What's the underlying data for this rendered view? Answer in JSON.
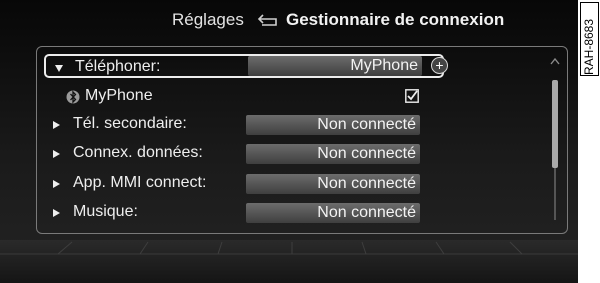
{
  "header": {
    "parent": "Réglages",
    "current": "Gestionnaire de connexion",
    "back_icon": "return-arrow-icon"
  },
  "rows": [
    {
      "label": "Téléphoner:",
      "value": "MyPhone",
      "expanded": true,
      "selected": true
    },
    {
      "label": "Tél. secondaire:",
      "value": "Non connecté"
    },
    {
      "label": "Connex. données:",
      "value": "Non connecté"
    },
    {
      "label": "App. MMI connect:",
      "value": "Non connecté"
    },
    {
      "label": "Musique:",
      "value": "Non connecté"
    }
  ],
  "subrow": {
    "icon": "bluetooth-icon",
    "label": "MyPhone",
    "checked": true
  },
  "add_icon": "plus-icon",
  "ref_code": "RAH-8683",
  "colors": {
    "background": "#0a0a0a",
    "field": "#555555",
    "text": "#eeeeee"
  }
}
